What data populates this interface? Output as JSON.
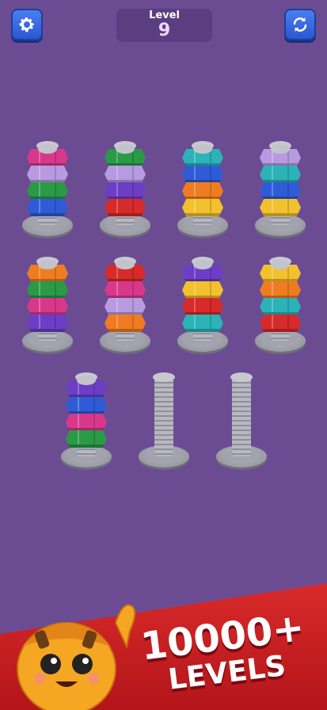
{
  "level": {
    "label": "Level",
    "number": "9"
  },
  "icons": {
    "settings": "gear-icon",
    "restart": "refresh-icon"
  },
  "colors": {
    "background": "#6b4c93",
    "button": "#3c6fe6",
    "pink": "#d8388c",
    "lavender": "#b79ae0",
    "green": "#2a9a46",
    "blue": "#2f5bd6",
    "purple": "#6d3ec5",
    "red": "#d72a2a",
    "teal": "#2bb3b8",
    "orange": "#f07c22",
    "yellow": "#f2c12e",
    "banner": "#d92a2a"
  },
  "rods": [
    {
      "nuts": [
        "pink",
        "lavender",
        "green",
        "blue"
      ]
    },
    {
      "nuts": [
        "green",
        "lavender",
        "purple",
        "red"
      ]
    },
    {
      "nuts": [
        "teal",
        "blue",
        "orange",
        "yellow"
      ]
    },
    {
      "nuts": [
        "lavender",
        "teal",
        "blue",
        "yellow"
      ]
    },
    {
      "nuts": [
        "orange",
        "green",
        "pink",
        "purple"
      ]
    },
    {
      "nuts": [
        "red",
        "pink",
        "lavender",
        "orange"
      ]
    },
    {
      "nuts": [
        "purple",
        "yellow",
        "red",
        "teal"
      ]
    },
    {
      "nuts": [
        "yellow",
        "orange",
        "teal",
        "red"
      ]
    },
    {
      "nuts": [
        "purple",
        "blue",
        "pink",
        "green"
      ]
    },
    {
      "nuts": []
    },
    {
      "nuts": []
    }
  ],
  "promo": {
    "line1": "10000+",
    "line2": "LEVELS"
  }
}
